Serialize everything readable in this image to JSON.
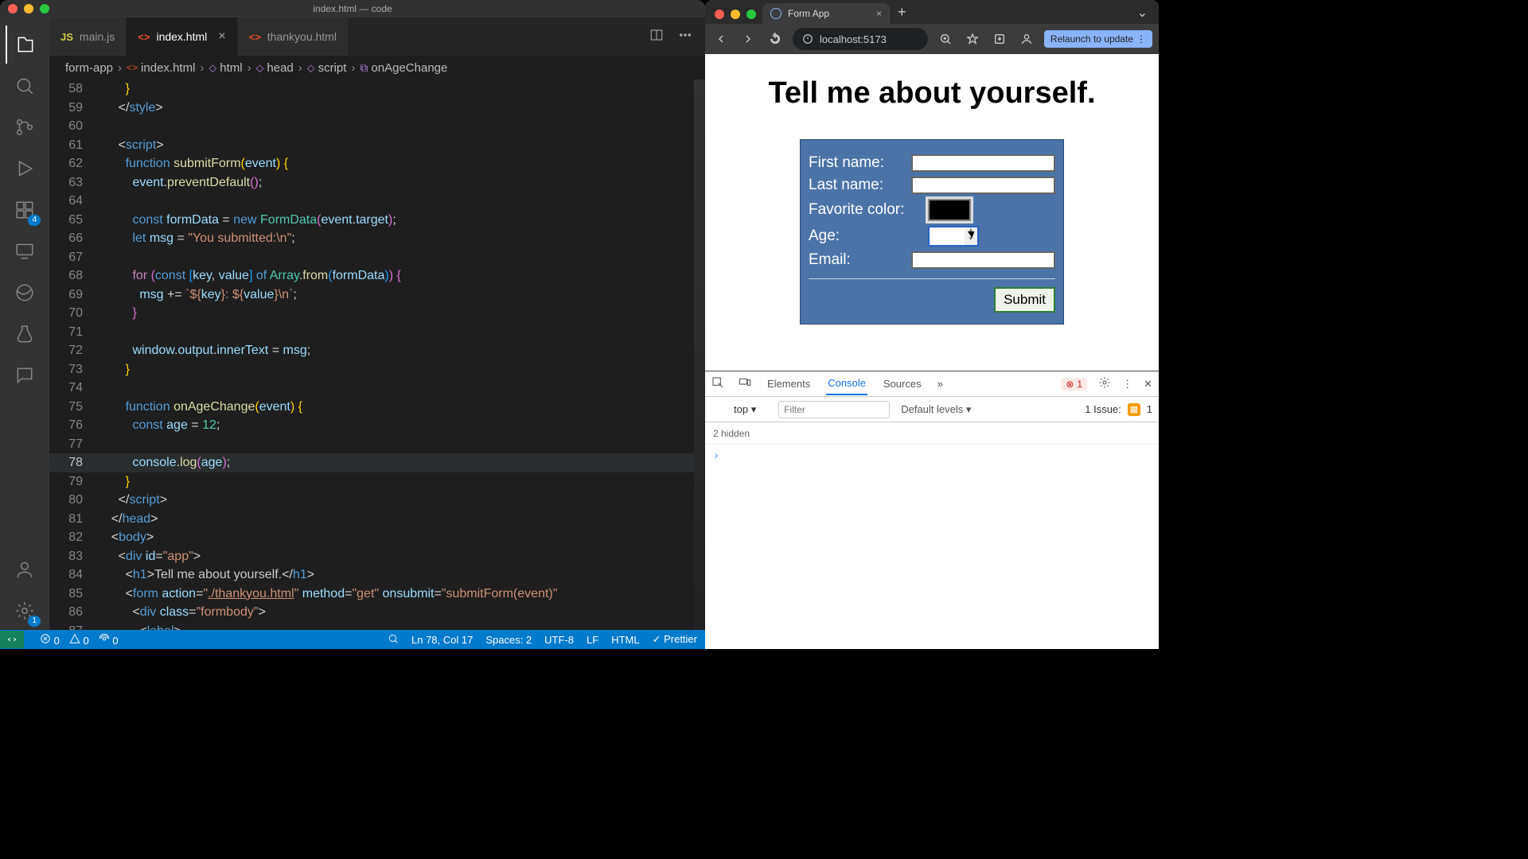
{
  "vscode": {
    "title": "index.html — code",
    "tabs": [
      {
        "icon": "js",
        "label": "main.js",
        "active": false,
        "close": false
      },
      {
        "icon": "html",
        "label": "index.html",
        "active": true,
        "close": true
      },
      {
        "icon": "html",
        "label": "thankyou.html",
        "active": false,
        "close": false
      }
    ],
    "breadcrumbs": [
      "form-app",
      "index.html",
      "html",
      "head",
      "script",
      "onAgeChange"
    ],
    "activity_badge_ext": "4",
    "activity_badge_settings": "1",
    "code_lines": [
      {
        "n": 58,
        "html": "        <span class='br1'>}</span>"
      },
      {
        "n": 59,
        "html": "      <span class='pun'>&lt;/</span><span class='tag'>style</span><span class='pun'>&gt;</span>"
      },
      {
        "n": 60,
        "html": ""
      },
      {
        "n": 61,
        "html": "      <span class='pun'>&lt;</span><span class='tag'>script</span><span class='pun'>&gt;</span>"
      },
      {
        "n": 62,
        "html": "        <span class='k'>function</span> <span class='fn'>submitForm</span><span class='br1'>(</span><span class='v'>event</span><span class='br1'>)</span> <span class='br1'>{</span>"
      },
      {
        "n": 63,
        "html": "          <span class='v'>event</span><span class='pun'>.</span><span class='fn'>preventDefault</span><span class='br2'>(</span><span class='br2'>)</span><span class='pun'>;</span>"
      },
      {
        "n": 64,
        "html": ""
      },
      {
        "n": 65,
        "html": "          <span class='k'>const</span> <span class='v'>formData</span> <span class='pun'>=</span> <span class='k'>new</span> <span class='t'>FormData</span><span class='br2'>(</span><span class='v'>event</span><span class='pun'>.</span><span class='v'>target</span><span class='br2'>)</span><span class='pun'>;</span>"
      },
      {
        "n": 66,
        "html": "          <span class='k'>let</span> <span class='v'>msg</span> <span class='pun'>=</span> <span class='s'>\"You submitted:\\n\"</span><span class='pun'>;</span>"
      },
      {
        "n": 67,
        "html": ""
      },
      {
        "n": 68,
        "html": "          <span class='p'>for</span> <span class='br2'>(</span><span class='k'>const</span> <span class='br3'>[</span><span class='v'>key</span><span class='pun'>,</span> <span class='v'>value</span><span class='br3'>]</span> <span class='k'>of</span> <span class='t'>Array</span><span class='pun'>.</span><span class='fn'>from</span><span class='br3'>(</span><span class='v'>formData</span><span class='br3'>)</span><span class='br2'>)</span> <span class='br2'>{</span>"
      },
      {
        "n": 69,
        "html": "            <span class='v'>msg</span> <span class='pun'>+=</span> <span class='s'>`${</span><span class='v'>key</span><span class='s'>}: ${</span><span class='v'>value</span><span class='s'>}\\n`</span><span class='pun'>;</span>"
      },
      {
        "n": 70,
        "html": "          <span class='br2'>}</span>"
      },
      {
        "n": 71,
        "html": ""
      },
      {
        "n": 72,
        "html": "          <span class='v'>window</span><span class='pun'>.</span><span class='v'>output</span><span class='pun'>.</span><span class='v'>innerText</span> <span class='pun'>=</span> <span class='v'>msg</span><span class='pun'>;</span>"
      },
      {
        "n": 73,
        "html": "        <span class='br1'>}</span>"
      },
      {
        "n": 74,
        "html": ""
      },
      {
        "n": 75,
        "html": "        <span class='k'>function</span> <span class='fn'>onAgeChange</span><span class='br1'>(</span><span class='v'>event</span><span class='br1'>)</span> <span class='br1'>{</span>"
      },
      {
        "n": 76,
        "html": "          <span class='k'>const</span> <span class='v'>age</span> <span class='pun'>=</span> <span class='t'>12</span><span class='pun'>;</span>"
      },
      {
        "n": 77,
        "html": ""
      },
      {
        "n": 78,
        "html": "          <span class='v'>console</span><span class='pun'>.</span><span class='fn'>log</span><span class='br2'>(</span><span class='v'>age</span><span class='br2'>)</span><span class='pun'>;</span>",
        "cur": true
      },
      {
        "n": 79,
        "html": "        <span class='br1'>}</span>"
      },
      {
        "n": 80,
        "html": "      <span class='pun'>&lt;/</span><span class='tag'>script</span><span class='pun'>&gt;</span>"
      },
      {
        "n": 81,
        "html": "    <span class='pun'>&lt;/</span><span class='tag'>head</span><span class='pun'>&gt;</span>"
      },
      {
        "n": 82,
        "html": "    <span class='pun'>&lt;</span><span class='tag'>body</span><span class='pun'>&gt;</span>"
      },
      {
        "n": 83,
        "html": "      <span class='pun'>&lt;</span><span class='tag'>div</span> <span class='attr'>id</span><span class='pun'>=</span><span class='s'>\"app\"</span><span class='pun'>&gt;</span>"
      },
      {
        "n": 84,
        "html": "        <span class='pun'>&lt;</span><span class='tag'>h1</span><span class='pun'>&gt;</span>Tell me about yourself.<span class='pun'>&lt;/</span><span class='tag'>h1</span><span class='pun'>&gt;</span>"
      },
      {
        "n": 85,
        "html": "        <span class='pun'>&lt;</span><span class='tag'>form</span> <span class='attr'>action</span><span class='pun'>=</span><span class='s'>\"<u>./thankyou.html</u>\"</span> <span class='attr'>method</span><span class='pun'>=</span><span class='s'>\"get\"</span> <span class='attr'>onsubmit</span><span class='pun'>=</span><span class='s'>\"submitForm(event)\"</span>"
      },
      {
        "n": 86,
        "html": "          <span class='pun'>&lt;</span><span class='tag'>div</span> <span class='attr'>class</span><span class='pun'>=</span><span class='s'>\"formbody\"</span><span class='pun'>&gt;</span>"
      },
      {
        "n": 87,
        "html": "            <span class='pun'>&lt;</span><span class='tag'>label</span><span class='pun'>&gt;</span>"
      }
    ],
    "status": {
      "errors": "0",
      "warnings": "0",
      "ports": "0",
      "cursor": "Ln 78, Col 17",
      "spaces": "Spaces: 2",
      "enc": "UTF-8",
      "eol": "LF",
      "lang": "HTML",
      "fmt": "Prettier"
    }
  },
  "chrome": {
    "tab_title": "Form App",
    "url": "localhost:5173",
    "relaunch": "Relaunch to update",
    "page": {
      "heading": "Tell me about yourself.",
      "labels": {
        "first": "First name:",
        "last": "Last name:",
        "color": "Favorite color:",
        "age": "Age:",
        "email": "Email:"
      },
      "submit": "Submit"
    },
    "devtools": {
      "tabs": [
        "Elements",
        "Console",
        "Sources"
      ],
      "active_tab": "Console",
      "err_count": "1",
      "top": "top",
      "filter_ph": "Filter",
      "levels": "Default levels",
      "issue_label": "1 Issue:",
      "issue_count": "1",
      "hidden": "2 hidden"
    }
  }
}
